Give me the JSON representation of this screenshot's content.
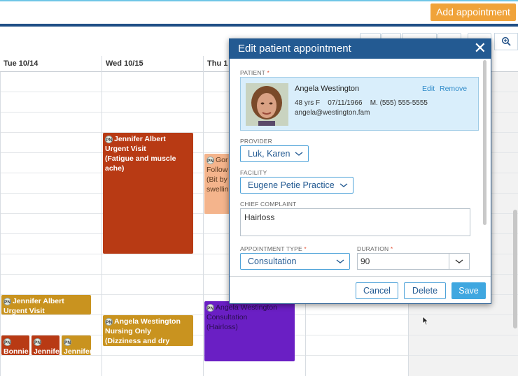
{
  "header": {
    "add_appointment_label": "Add appointment"
  },
  "calendar": {
    "columns": [
      "Tue 10/14",
      "Wed 10/15",
      "Thu 1"
    ],
    "appointments": {
      "jennifer_wed": {
        "badge": "PN",
        "name": "Jennifer Albert",
        "type": "Urgent Visit",
        "note": "(Fatigue and muscle ache)"
      },
      "thu_peach": {
        "badge": "PN",
        "line1": "Gor",
        "line2": "Follow",
        "line3": "(Bit by",
        "line4": "swellin"
      },
      "jennifer_tue": {
        "badge": "PN",
        "name": "Jennifer Albert",
        "type": "Urgent Visit"
      },
      "angela_wed": {
        "badge": "PN",
        "name": "Angela Westington",
        "type": "Nursing Only",
        "note": "(Dizziness and dry mouth)"
      },
      "angela_thu": {
        "badge": "PN",
        "name": "Angela Westington",
        "type": "Consultation",
        "note": "(Hairloss)"
      },
      "small1": {
        "badge": "PN",
        "name": "Bonnie"
      },
      "small2": {
        "badge": "PN",
        "name": "Jennifer"
      },
      "small3": {
        "badge": "PN",
        "name": "Jennifer"
      }
    }
  },
  "modal": {
    "title": "Edit patient appointment",
    "patient_label": "PATIENT",
    "required_mark": "*",
    "patient": {
      "name": "Angela Westington",
      "edit_label": "Edit",
      "remove_label": "Remove",
      "age_sex": "48 yrs F",
      "dob": "07/11/1966",
      "phone": "M. (555) 555-5555",
      "email": "angela@westington.fam"
    },
    "provider_label": "PROVIDER",
    "provider_value": "Luk, Karen",
    "facility_label": "FACILITY",
    "facility_value": "Eugene Petie Practice",
    "complaint_label": "CHIEF COMPLAINT",
    "complaint_value": "Hairloss",
    "appt_type_label": "APPOINTMENT TYPE",
    "appt_type_value": "Consultation",
    "duration_label": "DURATION",
    "duration_value": "90",
    "buttons": {
      "cancel": "Cancel",
      "delete": "Delete",
      "save": "Save"
    }
  },
  "colors": {
    "brand_blue": "#235a92",
    "add_button": "#f0a33a",
    "urgent_red": "#b83a14",
    "peach": "#f4b48c",
    "mustard": "#c9931f",
    "purple": "#6a1fc4",
    "save_blue": "#3fa7e0"
  }
}
